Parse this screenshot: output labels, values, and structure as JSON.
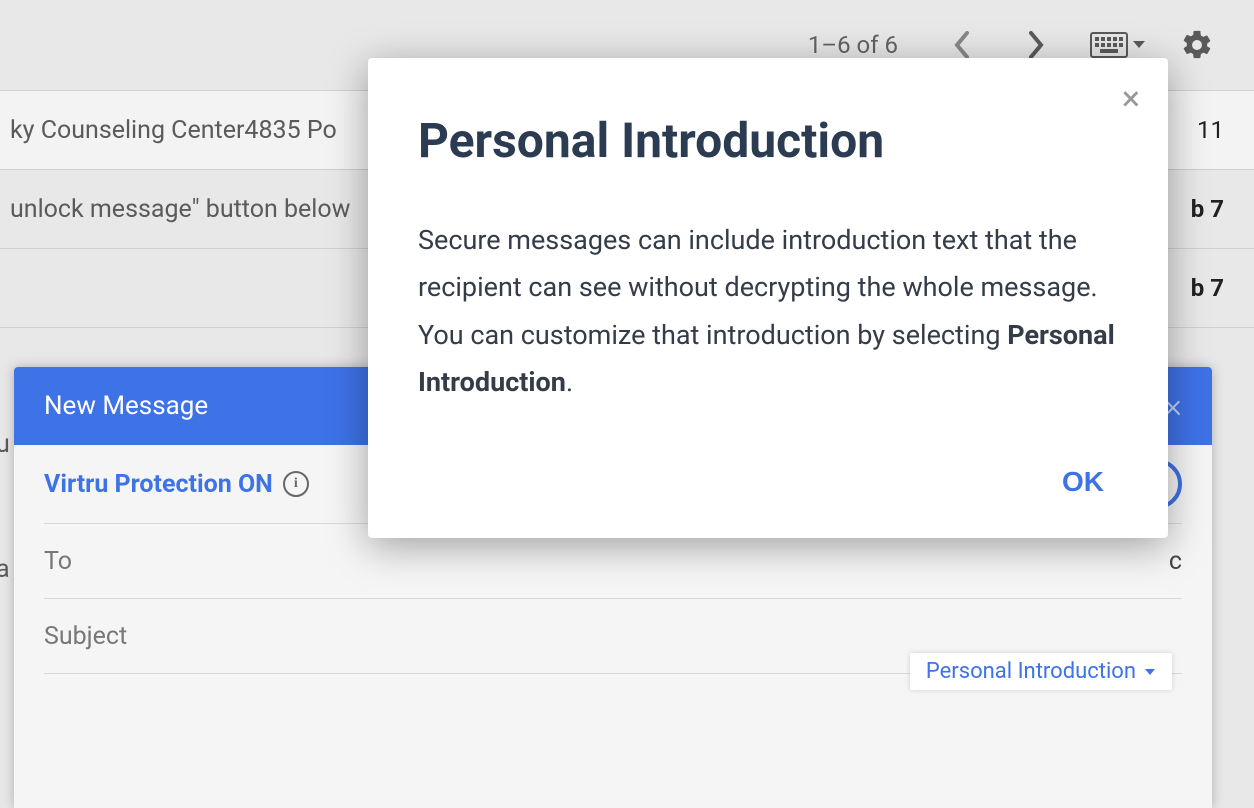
{
  "toolbar": {
    "page_count": "1–6 of 6"
  },
  "mail_rows": [
    {
      "snippet": "ky Counseling Center4835 Po",
      "date": "11",
      "bold": false,
      "unread": true
    },
    {
      "snippet": "unlock message\" button below",
      "date": "b 7",
      "bold": true,
      "unread": false
    },
    {
      "snippet": "",
      "date": "b 7",
      "bold": true,
      "unread": false
    }
  ],
  "edge": {
    "t1": "u",
    "t2": "a"
  },
  "compose": {
    "title": "New Message",
    "virtru_label": "Virtru Protection ON",
    "to_label": "To",
    "to_hint": "c",
    "subject_label": "Subject",
    "personal_intro_label": "Personal Introduction"
  },
  "modal": {
    "heading": "Personal Introduction",
    "body_prefix": "Secure messages can include introduction text that the recipient can see without decrypting the whole message. You can customize that introduction by selecting ",
    "body_bold": "Personal Introduction",
    "body_suffix": ".",
    "ok_label": "OK"
  }
}
